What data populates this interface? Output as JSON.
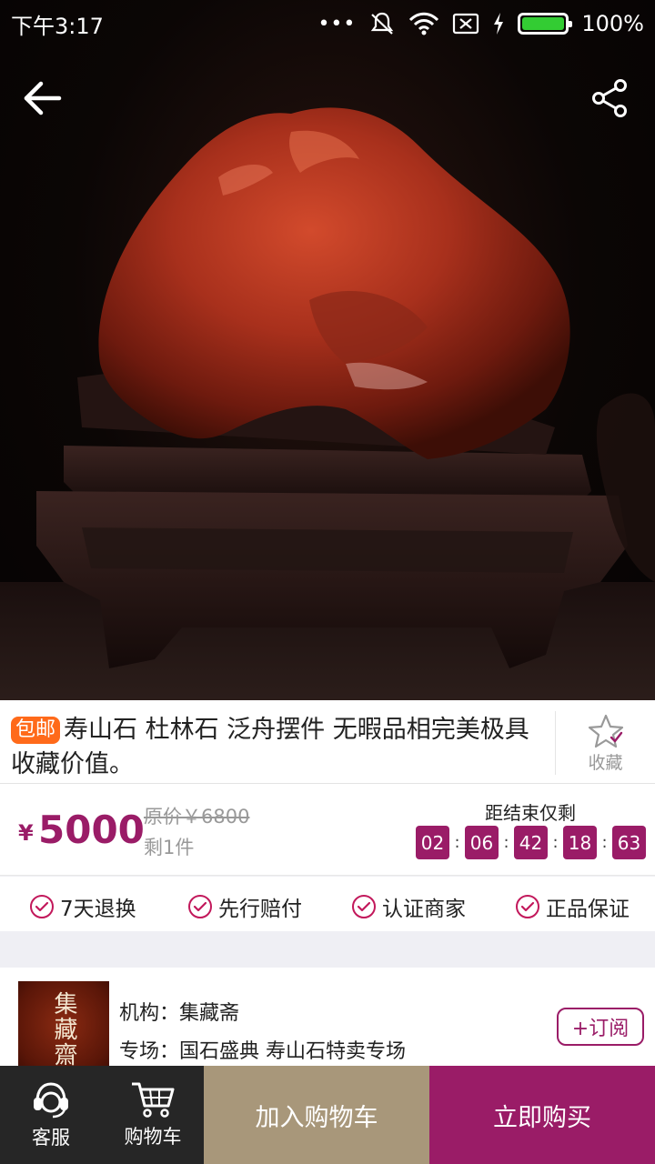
{
  "status_bar": {
    "time": "下午3:17",
    "battery": "100%"
  },
  "hero": {
    "icons": [
      "back-arrow-icon",
      "share-icon"
    ]
  },
  "product": {
    "badge": "包邮",
    "title": "寿山石 杜林石 泛舟摆件 无暇品相完美极具收藏价值。",
    "favorite_label": "收藏",
    "price_symbol": "¥",
    "price": "5000",
    "original_price": "原价￥6800",
    "stock": "剩1件"
  },
  "countdown": {
    "label": "距结束仅剩",
    "values": [
      "02",
      "06",
      "42",
      "18",
      "63"
    ]
  },
  "guarantees": [
    "7天退换",
    "先行赔付",
    "认证商家",
    "正品保证"
  ],
  "shop": {
    "logo_text": "集藏齋",
    "org": "机构：集藏斋",
    "venue": "专场：国石盛典 寿山石特卖专场",
    "subscribe": "+订阅"
  },
  "bottom_bar": {
    "service": "客服",
    "cart": "购物车",
    "add_to_cart": "加入购物车",
    "buy_now": "立即购买"
  },
  "colors": {
    "accent": "#9a1c67",
    "badge": "#ff6a1a",
    "cart_button": "#a8977a",
    "bottom_dark": "#262626"
  }
}
